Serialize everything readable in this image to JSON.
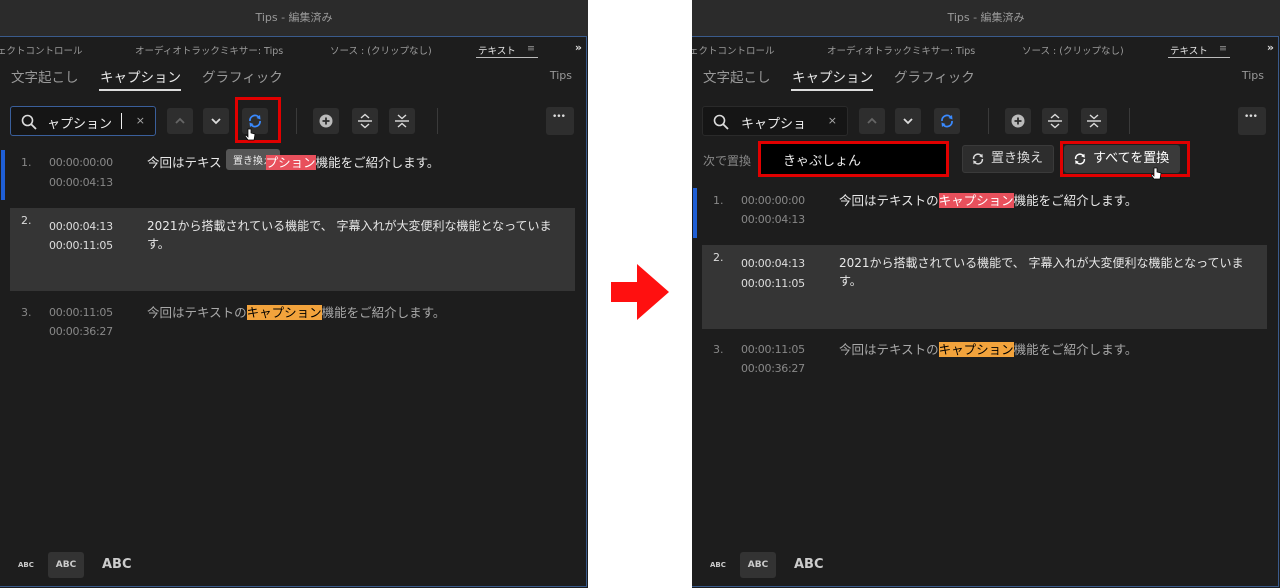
{
  "window_title": "Tips - 編集済み",
  "panel_tabs": [
    "ェクトコントロール",
    "オーディオトラックミキサー: Tips",
    "ソース : (クリップなし)",
    "テキスト",
    "≡",
    "»"
  ],
  "sub_tabs": [
    "文字起こし",
    "キャプション",
    "グラフィック"
  ],
  "sequence_name": "Tips",
  "search": {
    "left_value": "ャプション",
    "right_value": "キャプショ"
  },
  "clear_symbol": "×",
  "more_symbol": "•••",
  "tooltip": "置き換え",
  "replace": {
    "label": "次で置換",
    "value": "きゃぷしょん",
    "replace_button": "置き換え",
    "replace_all_button": "すべてを置換"
  },
  "captions": [
    {
      "num": "1.",
      "start": "00:00:00:00",
      "end": "00:00:04:13",
      "pre": "今回はテキストの",
      "highlight": "キャプション",
      "post": "機能をご紹介します。",
      "left_visible_pre": "今回はテキス",
      "left_visible_hl": "プション",
      "left_visible_post": "機能をご紹介します。"
    },
    {
      "num": "2.",
      "start": "00:00:04:13",
      "end": "00:00:11:05",
      "text": "2021から搭載されている機能で、 字幕入れが大変便利な機能となっています。"
    },
    {
      "num": "3.",
      "start": "00:00:11:05",
      "end": "00:00:36:27",
      "pre": "今回はテキストの",
      "highlight": "キャプション",
      "post": "機能をご紹介します。"
    }
  ],
  "text_size_buttons": [
    "ABC",
    "ABC",
    "ABC"
  ],
  "colors": {
    "accent": "#1f5fd6",
    "highlight_current": "#e8505c",
    "highlight_other": "#f2a33c",
    "callout": "#e10000"
  }
}
